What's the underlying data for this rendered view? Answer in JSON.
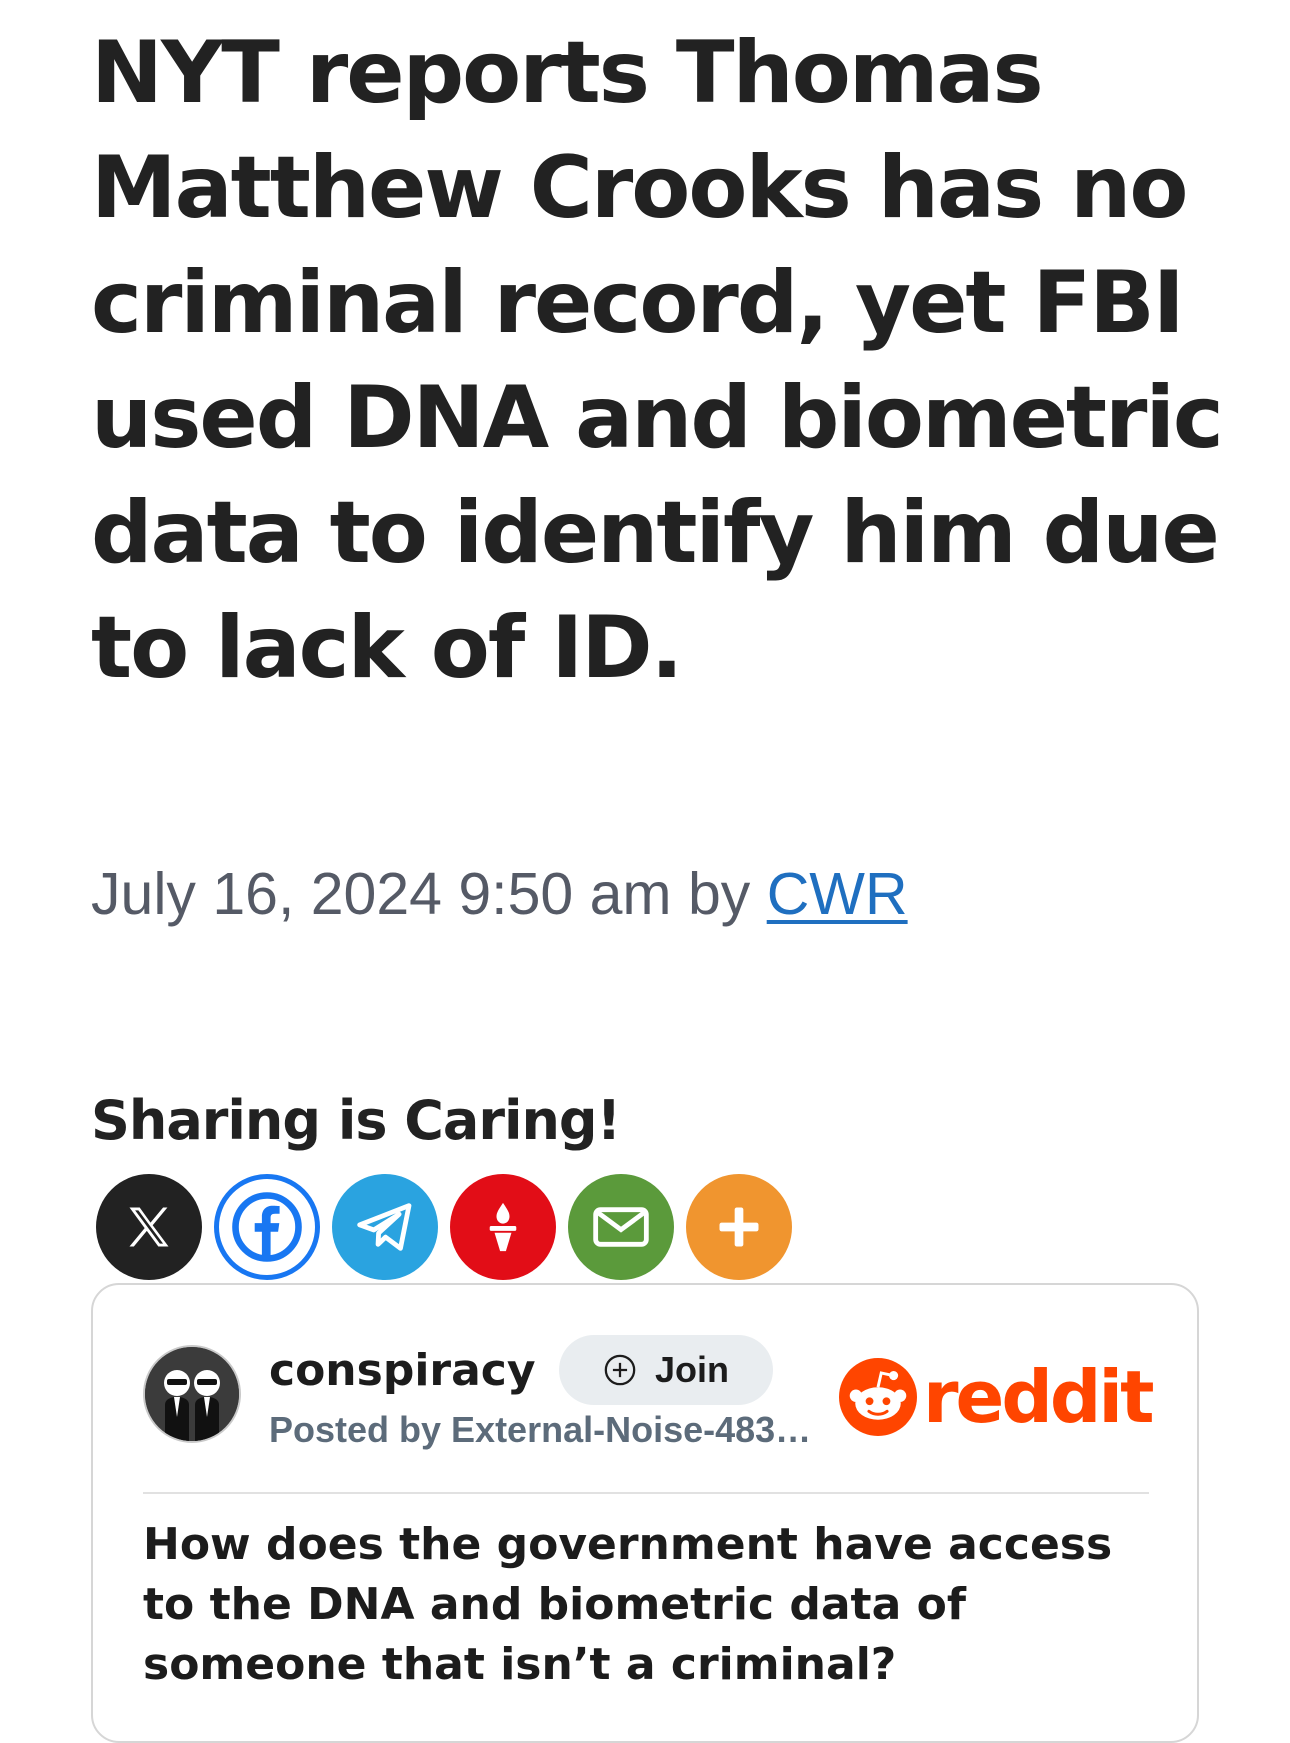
{
  "article": {
    "headline": "NYT reports Thomas Matthew Crooks has no criminal record, yet FBI used DNA and biometric data to identify him due to lack of ID.",
    "date": "July 16, 2024 9:50 am",
    "by_label": "by",
    "author": "CWR"
  },
  "share": {
    "title": "Sharing is Caring!",
    "buttons": [
      {
        "icon": "x-icon",
        "color": "#222222"
      },
      {
        "icon": "facebook-icon",
        "color": "#1877f2"
      },
      {
        "icon": "telegram-icon",
        "color": "#2aa3e0"
      },
      {
        "icon": "gettr-icon",
        "color": "#e20d17"
      },
      {
        "icon": "email-icon",
        "color": "#5b9a3b"
      },
      {
        "icon": "plus-icon",
        "color": "#f0952f"
      }
    ]
  },
  "reddit_embed": {
    "subreddit": "conspiracy",
    "join_label": "Join",
    "posted_by": "Posted by External-Noise-483…",
    "brand": "reddit",
    "brand_color": "#ff4500",
    "post_title": "How does the government have access to the DNA and biometric data of someone that isn’t a criminal?"
  }
}
